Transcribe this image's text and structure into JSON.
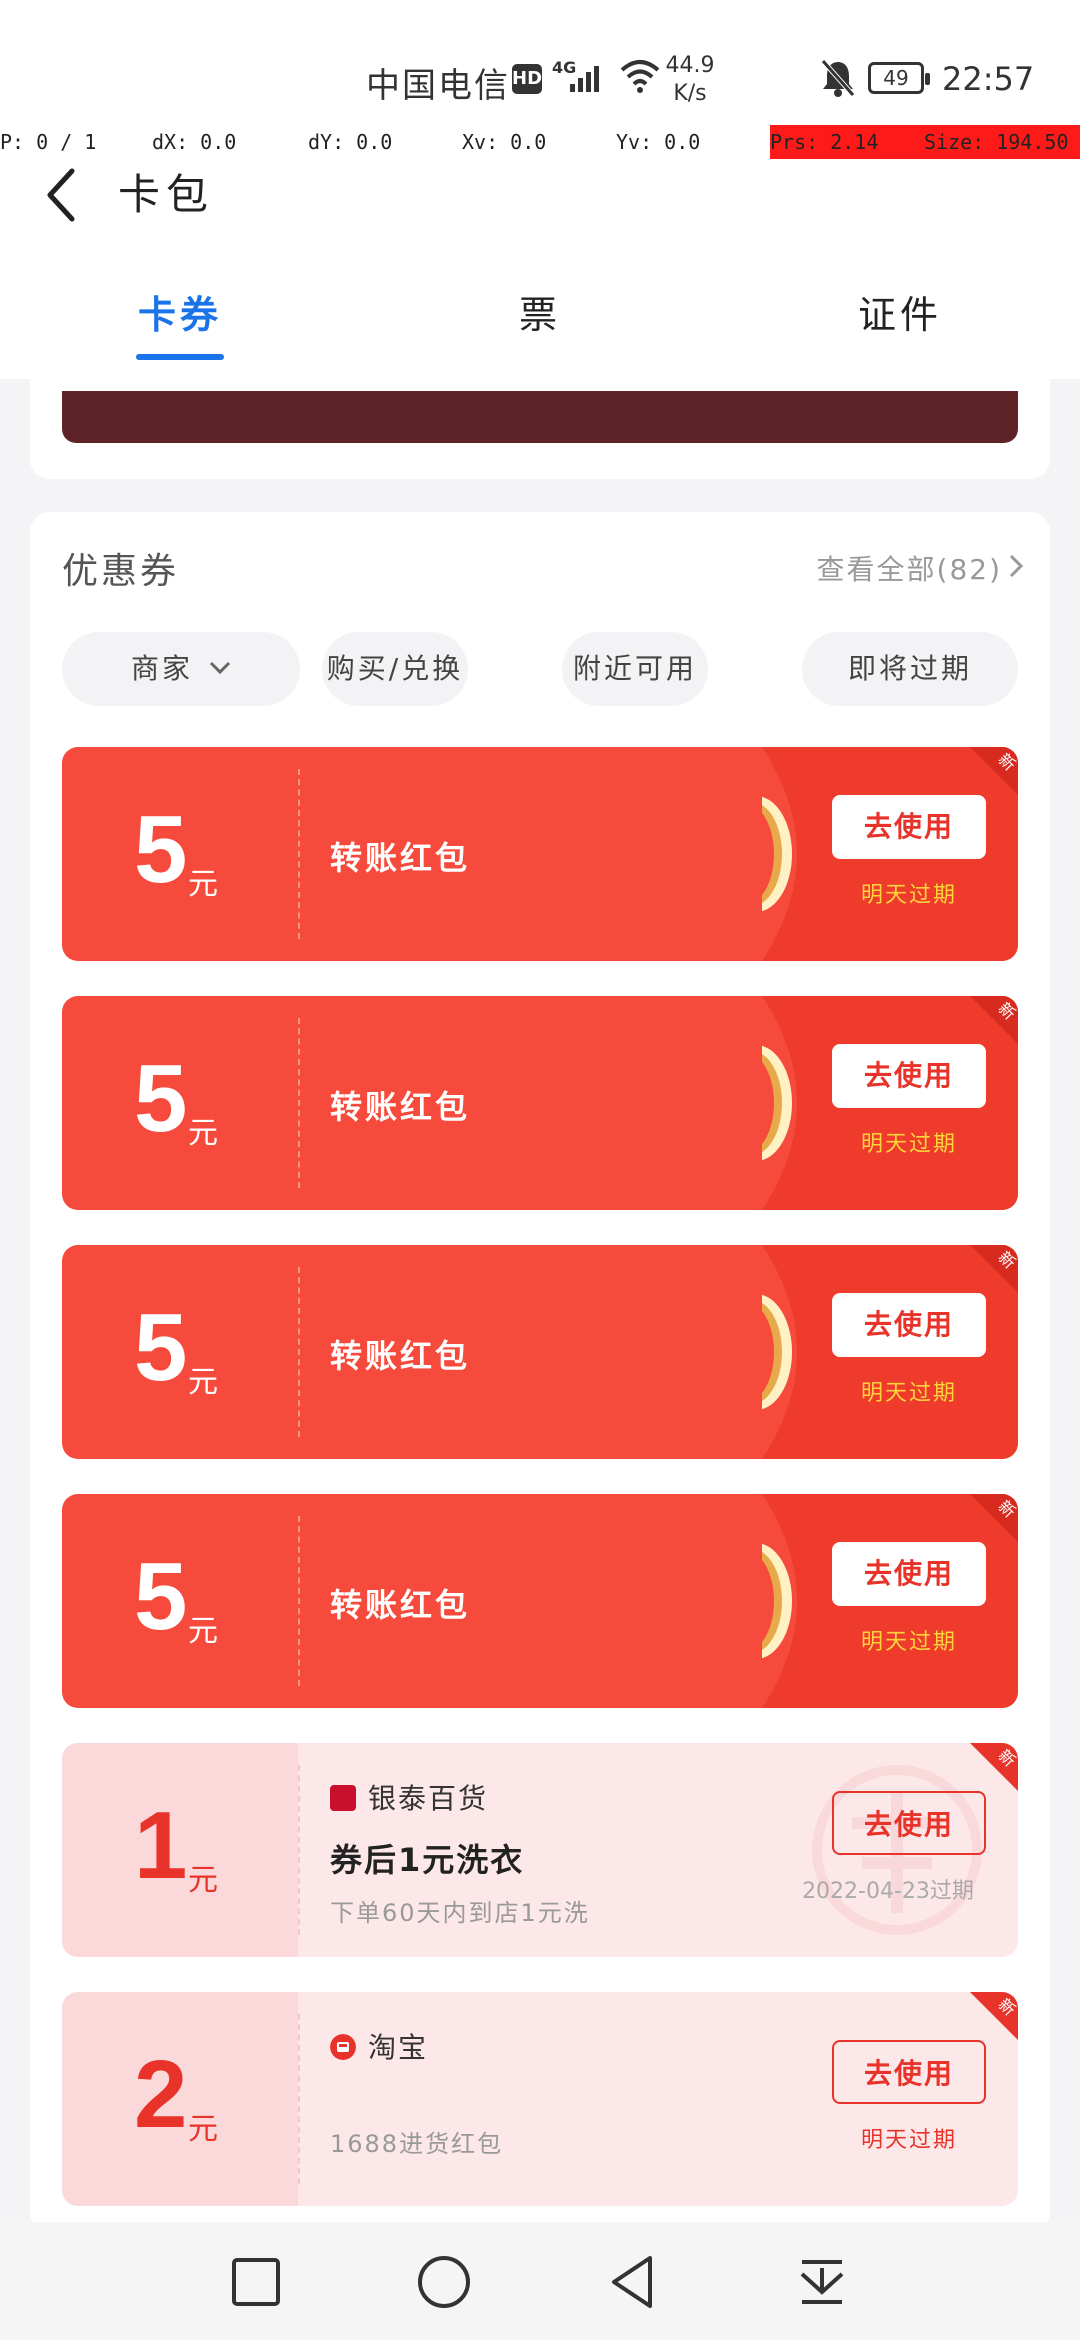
{
  "status_bar": {
    "carrier": "中国电信",
    "hd": "HD",
    "network": "4G",
    "speed_value": "44.9",
    "speed_unit": "K/s",
    "battery": "49",
    "time": "22:57"
  },
  "debug": {
    "p": "P: 0 / 1",
    "dx": "dX: 0.0",
    "dy": "dY: 0.0",
    "xv": "Xv: 0.0",
    "yv": "Yv: 0.0",
    "prs": "Prs: 2.14",
    "size": "Size: 194.50"
  },
  "header": {
    "title": "卡包",
    "tabs": [
      "卡券",
      "票",
      "证件"
    ],
    "active_tab": 0
  },
  "coupons_section": {
    "title": "优惠券",
    "view_all": "查看全部(82)",
    "filters": [
      "商家",
      "购买/兑换",
      "附近可用",
      "即将过期"
    ]
  },
  "coupons": [
    {
      "amount": "5",
      "unit": "元",
      "name": "转账红包",
      "button": "去使用",
      "expire": "明天过期",
      "tag": "新"
    },
    {
      "amount": "5",
      "unit": "元",
      "name": "转账红包",
      "button": "去使用",
      "expire": "明天过期",
      "tag": "新"
    },
    {
      "amount": "5",
      "unit": "元",
      "name": "转账红包",
      "button": "去使用",
      "expire": "明天过期",
      "tag": "新"
    },
    {
      "amount": "5",
      "unit": "元",
      "name": "转账红包",
      "button": "去使用",
      "expire": "明天过期",
      "tag": "新"
    },
    {
      "amount": "1",
      "unit": "元",
      "merchant": "银泰百货",
      "title": "券后1元洗衣",
      "desc": "下单60天内到店1元洗",
      "button": "去使用",
      "expire": "2022-04-23过期",
      "tag": "新"
    },
    {
      "amount": "2",
      "unit": "元",
      "merchant": "淘宝",
      "desc": "1688进货红包",
      "button": "去使用",
      "expire": "明天过期",
      "tag": "新"
    }
  ],
  "colors": {
    "accent": "#1a73e8",
    "coupon_red": "#f64b3c",
    "expire_yellow": "#ffd43b",
    "banner": "#5e2326"
  }
}
